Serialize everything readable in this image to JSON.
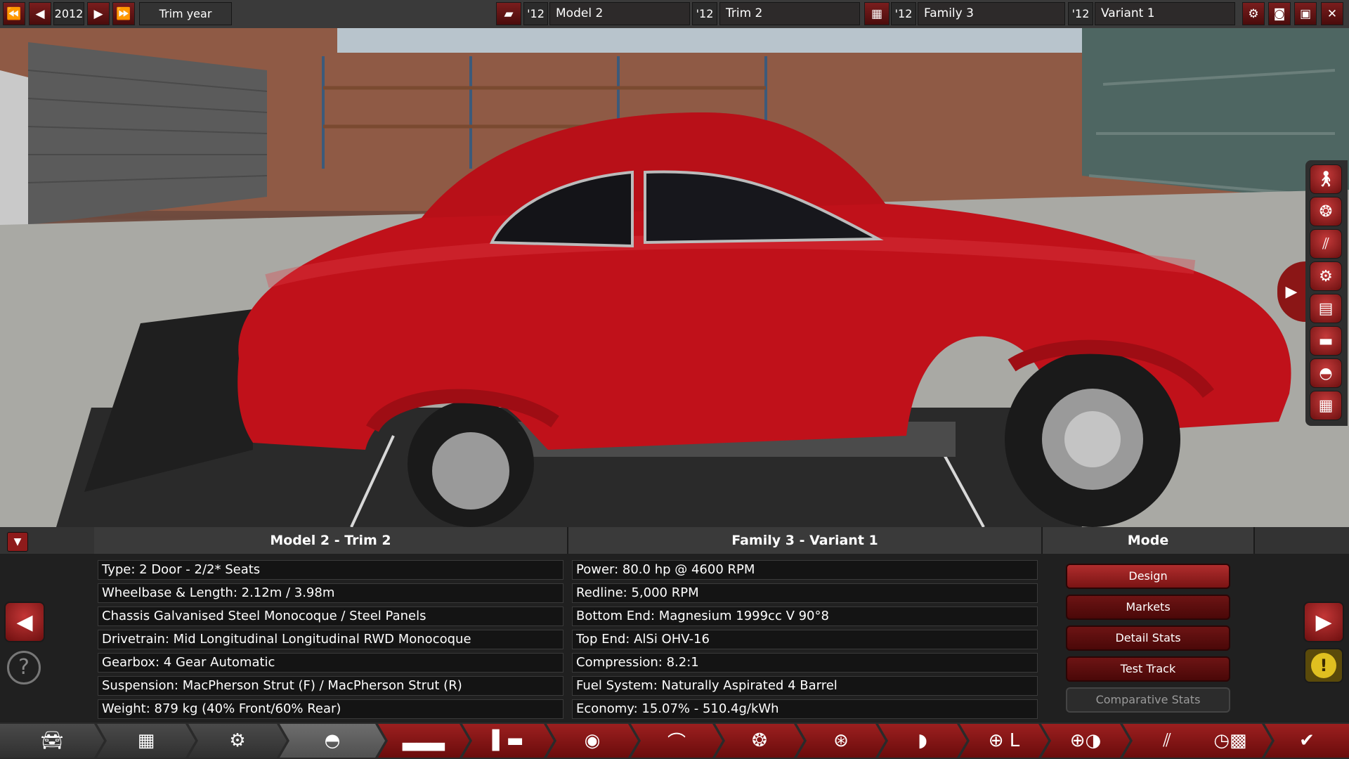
{
  "topbar": {
    "year": "2012",
    "trim_year_label": "Trim year",
    "model_year": "'12",
    "model_name": "Model 2",
    "trim_year": "'12",
    "trim_name": "Trim 2",
    "family_year": "'12",
    "family_name": "Family 3",
    "variant_year": "'12",
    "variant_name": "Variant 1"
  },
  "info": {
    "col1_header": "Model 2 - Trim 2",
    "col2_header": "Family 3 - Variant 1",
    "mode_header": "Mode",
    "car_rows": [
      "Type: 2 Door - 2/2* Seats",
      "Wheelbase & Length: 2.12m / 3.98m",
      "Chassis Galvanised Steel Monocoque / Steel Panels",
      "Drivetrain: Mid Longitudinal Longitudinal RWD Monocoque",
      "Gearbox: 4 Gear Automatic",
      "Suspension: MacPherson Strut (F) / MacPherson Strut (R)",
      "Weight: 879 kg (40% Front/60% Rear)"
    ],
    "engine_rows": [
      "Power: 80.0 hp @ 4600 RPM",
      "Redline:  5,000 RPM",
      "Bottom End: Magnesium 1999cc V 90°8",
      "Top End: AlSi OHV-16",
      "Compression: 8.2:1",
      "Fuel System: Naturally Aspirated 4 Barrel",
      "Economy: 15.07% - 510.4g/kWh"
    ],
    "modes": [
      "Design",
      "Markets",
      "Detail Stats",
      "Test Track",
      "Comparative Stats"
    ]
  },
  "colors": {
    "accent": "#8b1616",
    "car": "#c0111a",
    "panel": "#202020"
  },
  "icons": {
    "sidebar": [
      "person-icon",
      "wheel-icon",
      "exhaust-icon",
      "engine-icon",
      "seat-icon",
      "car-roof-icon",
      "car-side-icon",
      "grille-icon"
    ],
    "nav": [
      "car-icon",
      "chassis-icon",
      "suspension-icon",
      "body-icon",
      "body-parts-icon",
      "trim-icon",
      "engine-block-icon",
      "cylinder-head-icon",
      "fuel-system-icon",
      "turbo-icon",
      "exhaust-icon",
      "gearbox-icon",
      "steering-icon",
      "wheels-icon",
      "testing-icon",
      "finish-icon"
    ]
  }
}
